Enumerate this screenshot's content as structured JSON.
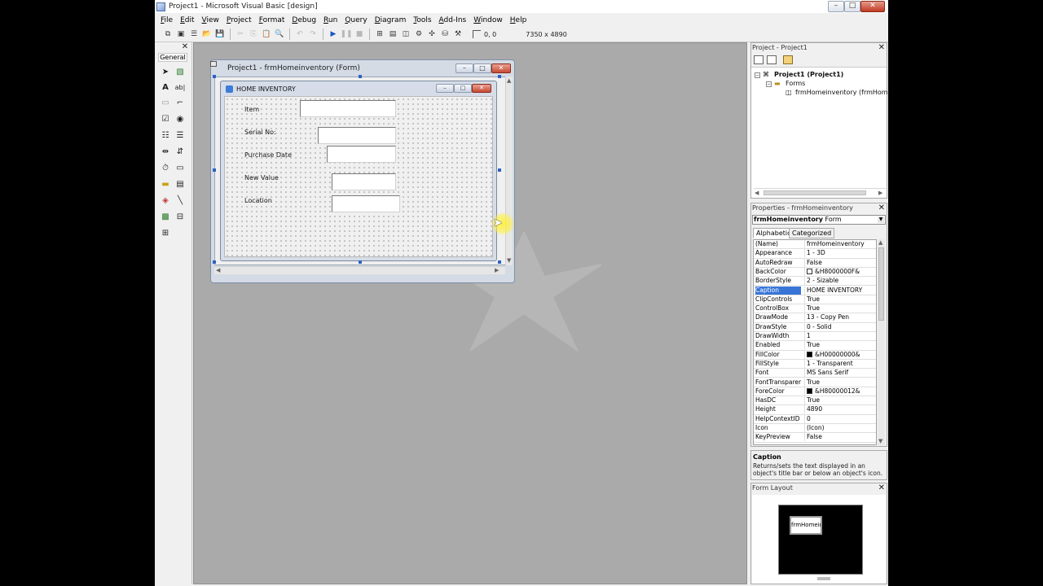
{
  "window": {
    "title": "Project1 - Microsoft Visual Basic [design]",
    "min": "–",
    "max": "□",
    "close": "✕"
  },
  "menu": [
    "File",
    "Edit",
    "View",
    "Project",
    "Format",
    "Debug",
    "Run",
    "Query",
    "Diagram",
    "Tools",
    "Add-Ins",
    "Window",
    "Help"
  ],
  "toolbar": {
    "position": "0, 0",
    "size": "7350 x 4890"
  },
  "toolbox": {
    "title": "General",
    "close": "✕"
  },
  "form_window": {
    "title": "Project1 - frmHomeinventory (Form)",
    "designed_form": {
      "caption": "HOME INVENTORY",
      "labels": [
        "Item",
        "Serial No:",
        "Purchase Date",
        "New Value",
        "Location"
      ]
    }
  },
  "project_pane": {
    "title": "Project - Project1",
    "close": "✕",
    "tree": {
      "root": "Project1 (Project1)",
      "folder": "Forms",
      "item": "frmHomeinventory (frmHomeinve"
    }
  },
  "properties_pane": {
    "title": "Properties - frmHomeinventory",
    "close": "✕",
    "object_name": "frmHomeinventory",
    "object_type": "Form",
    "tabs": [
      "Alphabetic",
      "Categorized"
    ],
    "rows": [
      {
        "name": "(Name)",
        "value": "frmHomeinventory"
      },
      {
        "name": "Appearance",
        "value": "1 - 3D"
      },
      {
        "name": "AutoRedraw",
        "value": "False"
      },
      {
        "name": "BackColor",
        "value": "&H8000000F&",
        "swatch": "#ffffff"
      },
      {
        "name": "BorderStyle",
        "value": "2 - Sizable"
      },
      {
        "name": "Caption",
        "value": "HOME INVENTORY",
        "selected": true
      },
      {
        "name": "ClipControls",
        "value": "True"
      },
      {
        "name": "ControlBox",
        "value": "True"
      },
      {
        "name": "DrawMode",
        "value": "13 - Copy Pen"
      },
      {
        "name": "DrawStyle",
        "value": "0 - Solid"
      },
      {
        "name": "DrawWidth",
        "value": "1"
      },
      {
        "name": "Enabled",
        "value": "True"
      },
      {
        "name": "FillColor",
        "value": "&H00000000&",
        "swatch": "#000000"
      },
      {
        "name": "FillStyle",
        "value": "1 - Transparent"
      },
      {
        "name": "Font",
        "value": "MS Sans Serif"
      },
      {
        "name": "FontTransparent",
        "value": "True"
      },
      {
        "name": "ForeColor",
        "value": "&H80000012&",
        "swatch": "#000000"
      },
      {
        "name": "HasDC",
        "value": "True"
      },
      {
        "name": "Height",
        "value": "4890"
      },
      {
        "name": "HelpContextID",
        "value": "0"
      },
      {
        "name": "Icon",
        "value": "(Icon)"
      },
      {
        "name": "KeyPreview",
        "value": "False"
      }
    ],
    "description_title": "Caption",
    "description_text": "Returns/sets the text displayed in an object's title bar or below an object's icon."
  },
  "layout_pane": {
    "title": "Form Layout",
    "close": "✕",
    "mini_form": "frmHomein"
  },
  "colors": {
    "selection": "#3875d7",
    "workspace": "#aaaaaa",
    "close_red": "#c13a22"
  }
}
